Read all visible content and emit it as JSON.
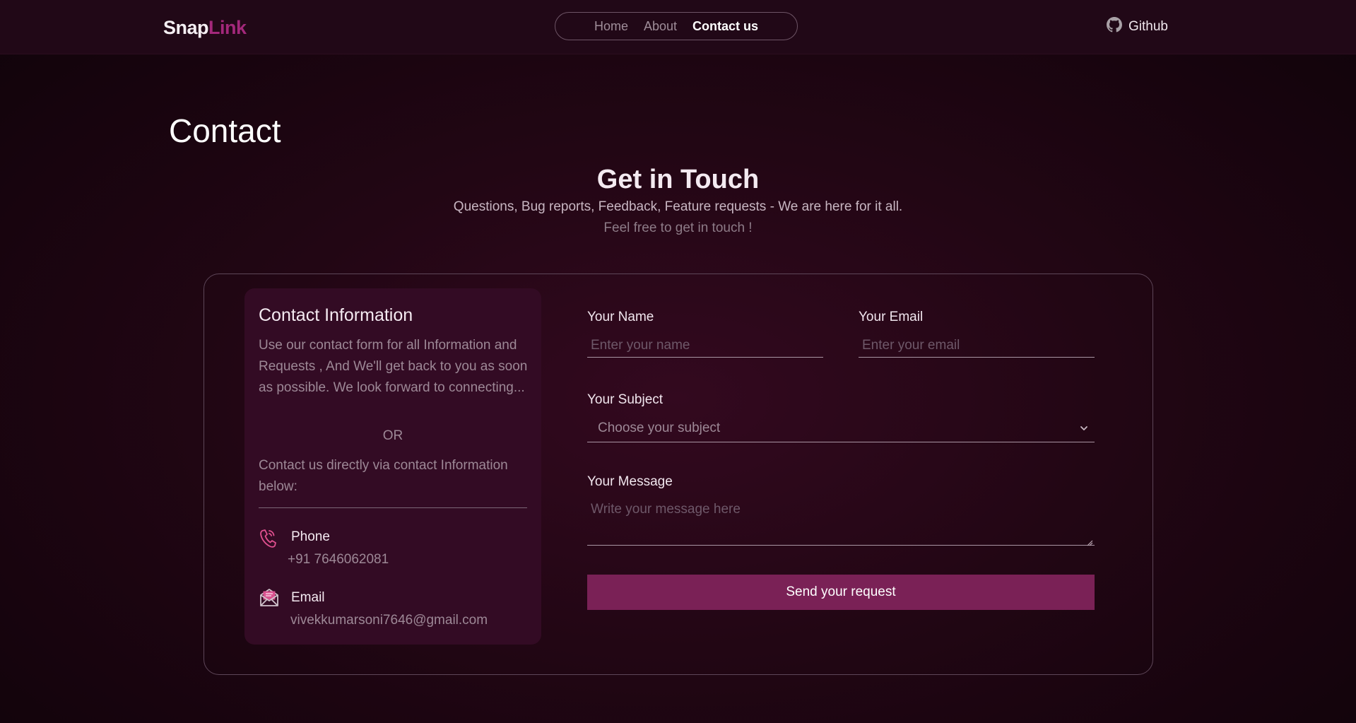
{
  "header": {
    "logo_part1": "Snap",
    "logo_part2": "Link",
    "nav": [
      {
        "label": "Home",
        "active": false
      },
      {
        "label": "About",
        "active": false
      },
      {
        "label": "Contact us",
        "active": true
      }
    ],
    "github_label": "Github",
    "github_icon": "github-icon"
  },
  "page": {
    "title": "Contact",
    "heading": "Get in Touch",
    "subheading": "Questions, Bug reports, Feedback, Feature requests - We are here for it all.",
    "subheading2": "Feel free to get in touch !"
  },
  "info": {
    "title": "Contact Information",
    "text": "Use our contact form for all Information and Requests , And We'll get back to you as soon as possible. We look forward to connecting...",
    "or": "OR",
    "text2": "Contact us directly via contact Information below:",
    "phone_label": "Phone",
    "phone_value": "+91 7646062081",
    "phone_icon": "phone-icon",
    "email_label": "Email",
    "email_value": "vivekkumarsoni7646@gmail.com",
    "email_icon": "mail-icon"
  },
  "form": {
    "name_label": "Your Name",
    "name_placeholder": "Enter your name",
    "email_label": "Your Email",
    "email_placeholder": "Enter your email",
    "subject_label": "Your Subject",
    "subject_value": "Choose your subject",
    "message_label": "Your Message",
    "message_placeholder": "Write your message here",
    "submit_label": "Send your request"
  },
  "colors": {
    "accent": "#a3287b",
    "button": "#7a2156",
    "header_bg": "#210817",
    "panel_bg": "#330b24"
  }
}
